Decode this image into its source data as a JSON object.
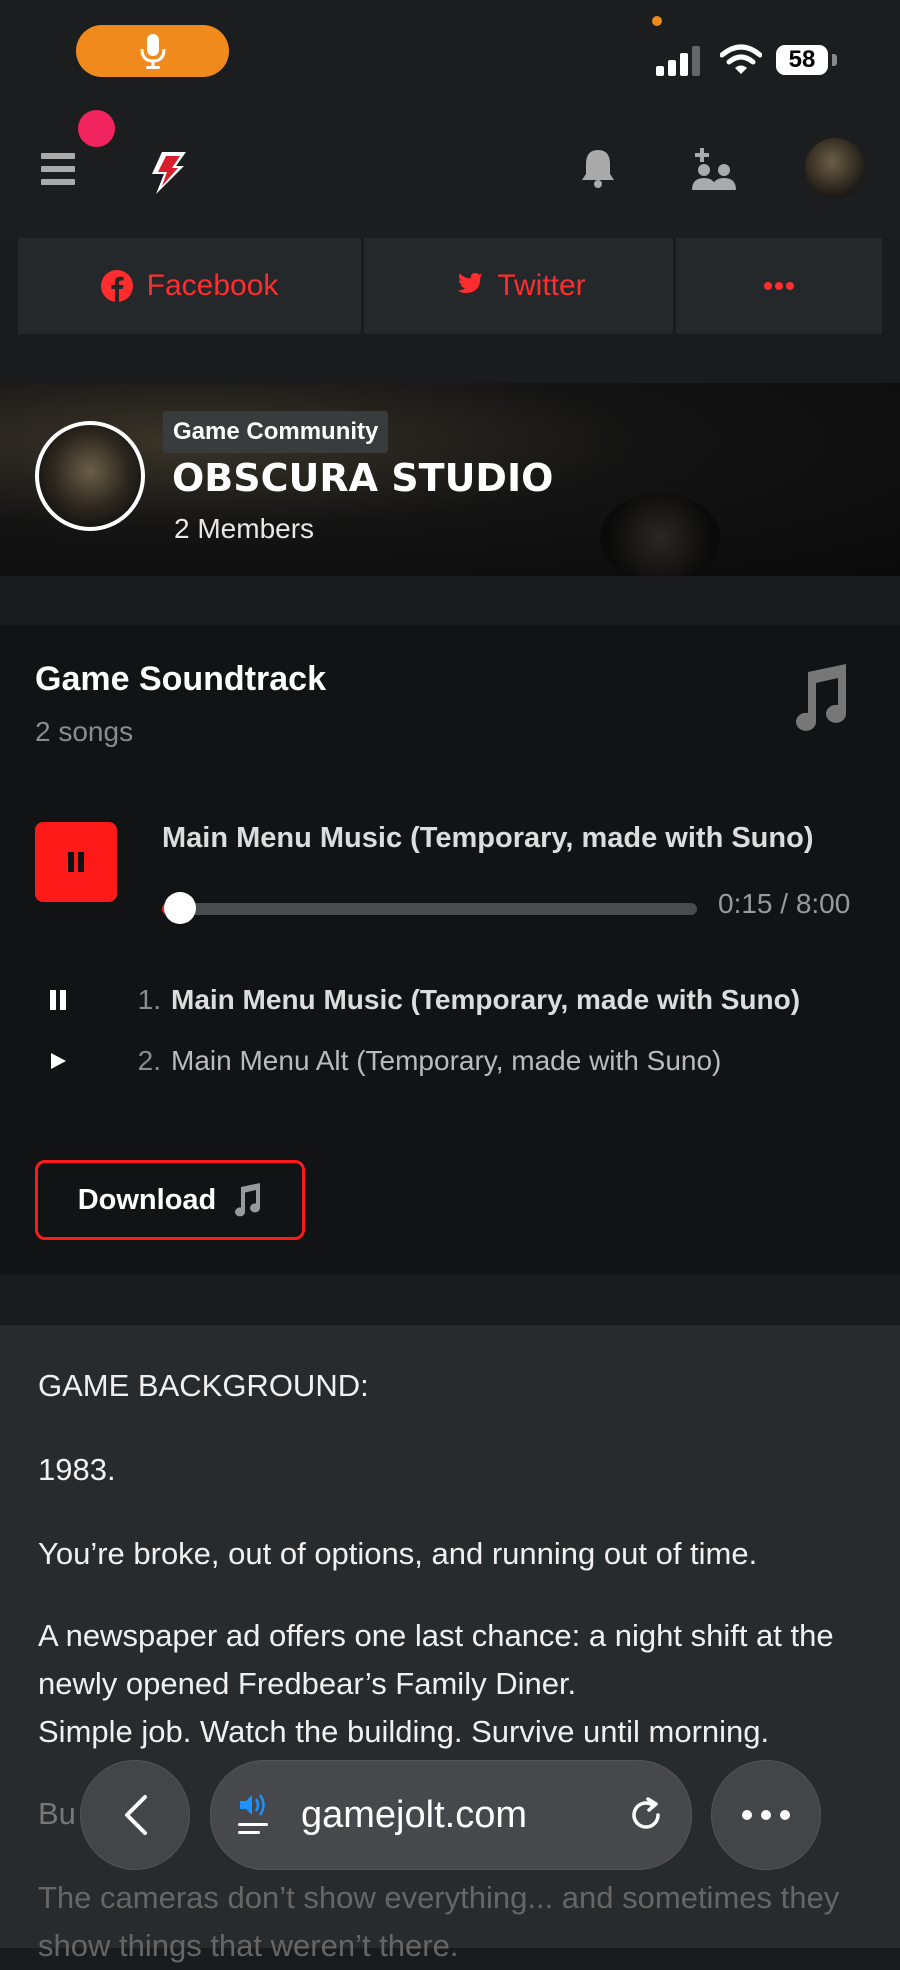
{
  "status_bar": {
    "battery": "58"
  },
  "share": {
    "facebook": "Facebook",
    "twitter": "Twitter"
  },
  "community": {
    "tag": "Game Community",
    "name": "OBSCURA STUDIO",
    "members": "2 Members"
  },
  "soundtrack": {
    "title": "Game Soundtrack",
    "count": "2 songs",
    "now_playing": "Main Menu Music (Temporary, made with Suno)",
    "progress_fraction": 0.031,
    "time": "0:15 / 8:00",
    "tracks": [
      {
        "num": "1.",
        "title": "Main Menu Music (Temporary, made with Suno)",
        "state": "playing"
      },
      {
        "num": "2.",
        "title": "Main Menu Alt (Temporary, made with Suno)",
        "state": "paused"
      }
    ],
    "download_label": "Download"
  },
  "description": {
    "heading": "GAME BACKGROUND:",
    "year": "1983.",
    "p1": "You’re broke, out of options, and running out of time.",
    "p2": "A newspaper ad offers one last chance: a night shift at the newly opened Fredbear’s Family Diner.",
    "p3": "Simple job. Watch the building. Survive until morning.",
    "p4_partial": "Bu",
    "p5": "The cameras don’t show everything... and sometimes they show things that weren’t there."
  },
  "browser": {
    "url": "gamejolt.com"
  },
  "colors": {
    "accent": "#ff1a1a",
    "orange": "#f08a1d",
    "notif": "#f1245f"
  }
}
